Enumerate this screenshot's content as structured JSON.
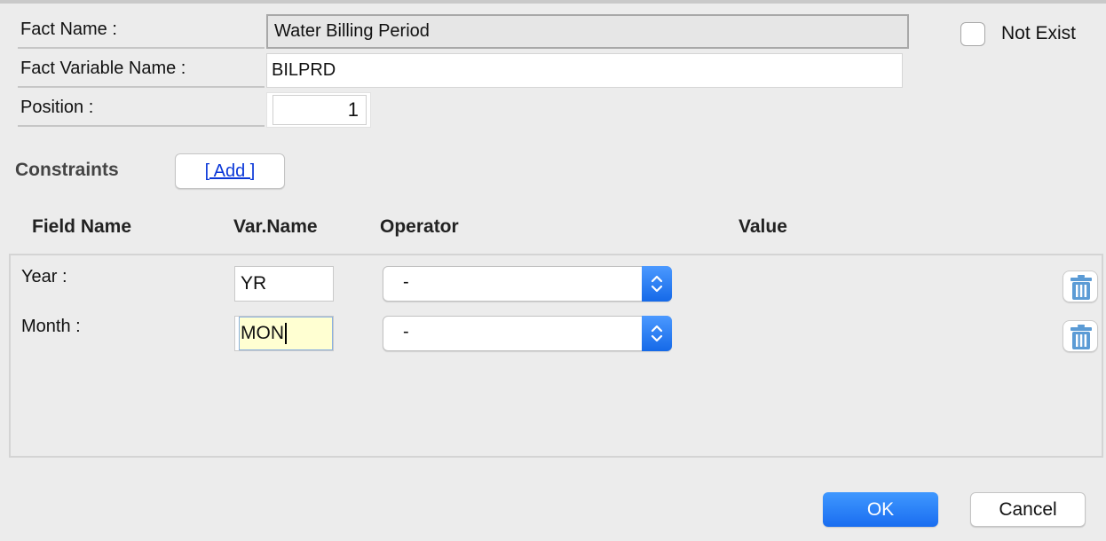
{
  "fact": {
    "name_label": "Fact Name :",
    "name_value": "Water Billing Period",
    "variable_label": "Fact Variable Name :",
    "variable_value": "BILPRD",
    "position_label": "Position :",
    "position_value": "1",
    "not_exist_label": "Not Exist",
    "not_exist_checked": false
  },
  "constraints": {
    "title": "Constraints",
    "add_label": "[ Add ]",
    "columns": [
      "Field Name",
      "Var.Name",
      "Operator",
      "Value"
    ],
    "rows": [
      {
        "field": "Year :",
        "var": "YR",
        "operator": "-",
        "active": false
      },
      {
        "field": "Month :",
        "var": "MON",
        "operator": "-",
        "active": true
      }
    ]
  },
  "buttons": {
    "ok": "OK",
    "cancel": "Cancel"
  },
  "colors": {
    "accent": "#1a6df0",
    "link": "#0a37d8",
    "active_field": "#ffffd2",
    "trash_icon": "#5b9bd5"
  }
}
